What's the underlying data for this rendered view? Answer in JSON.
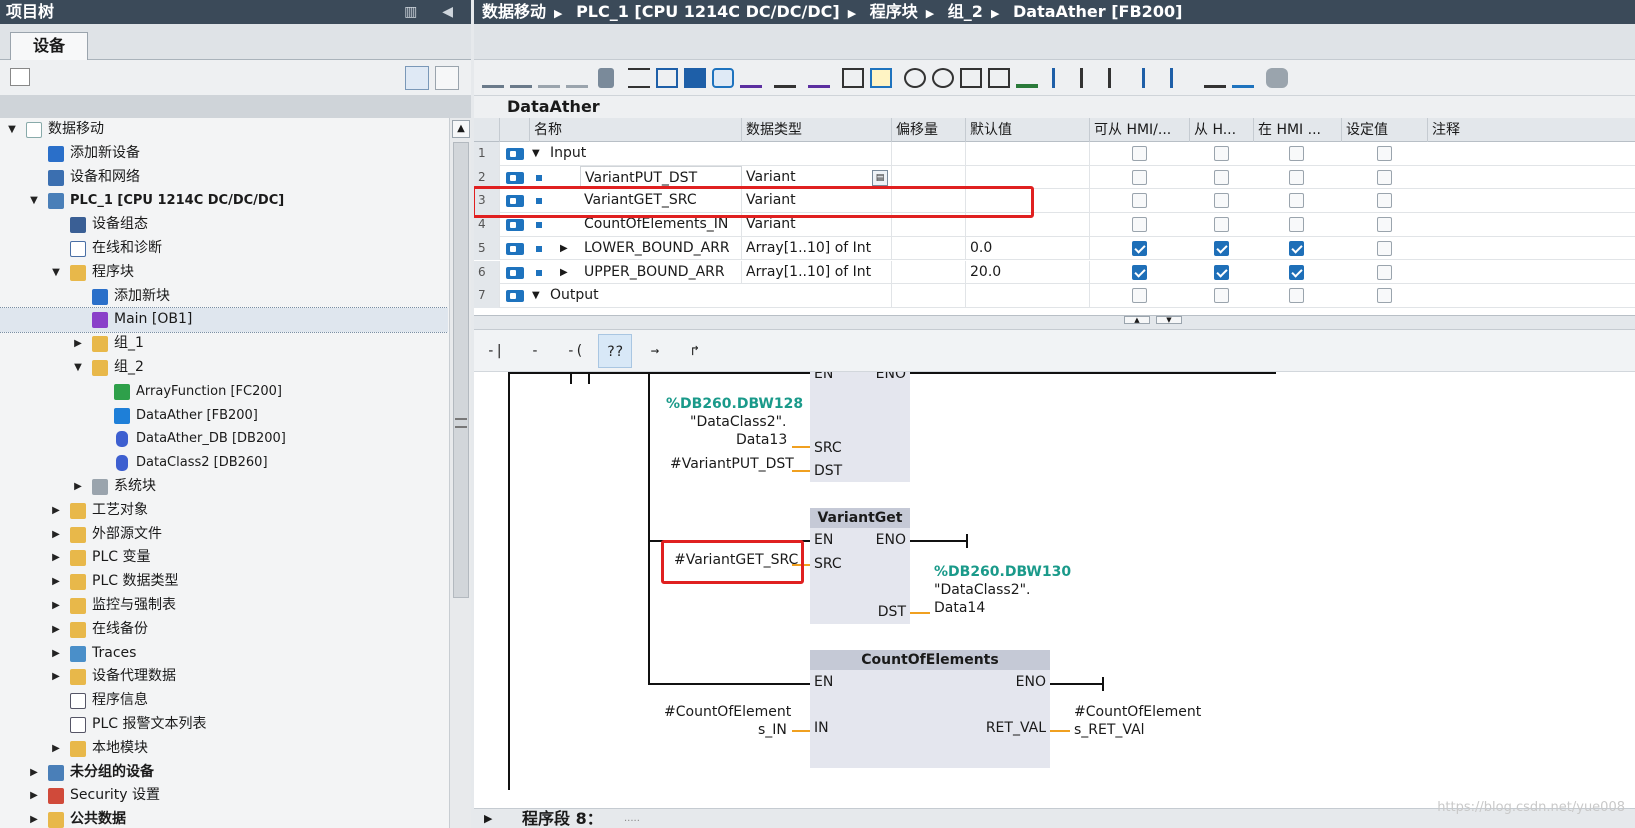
{
  "project_tree": {
    "title": "项目树",
    "tab": "设备",
    "items": [
      {
        "label": "数据移动",
        "bold": false
      },
      {
        "label": "添加新设备",
        "bold": false
      },
      {
        "label": "设备和网络",
        "bold": false
      },
      {
        "label": "PLC_1 [CPU 1214C DC/DC/DC]",
        "bold": true
      },
      {
        "label": "设备组态",
        "bold": false
      },
      {
        "label": "在线和诊断",
        "bold": false
      },
      {
        "label": "程序块",
        "bold": false
      },
      {
        "label": "添加新块",
        "bold": false
      },
      {
        "label": "Main [OB1]",
        "bold": false
      },
      {
        "label": "组_1",
        "bold": false
      },
      {
        "label": "组_2",
        "bold": false
      },
      {
        "label": "ArrayFunction [FC200]",
        "bold": false
      },
      {
        "label": "DataAther [FB200]",
        "bold": false
      },
      {
        "label": "DataAther_DB [DB200]",
        "bold": false
      },
      {
        "label": "DataClass2 [DB260]",
        "bold": false
      },
      {
        "label": "系统块",
        "bold": false
      },
      {
        "label": "工艺对象",
        "bold": false
      },
      {
        "label": "外部源文件",
        "bold": false
      },
      {
        "label": "PLC 变量",
        "bold": false
      },
      {
        "label": "PLC 数据类型",
        "bold": false
      },
      {
        "label": "监控与强制表",
        "bold": false
      },
      {
        "label": "在线备份",
        "bold": false
      },
      {
        "label": "Traces",
        "bold": false
      },
      {
        "label": "设备代理数据",
        "bold": false
      },
      {
        "label": "程序信息",
        "bold": false
      },
      {
        "label": "PLC 报警文本列表",
        "bold": false
      },
      {
        "label": "本地模块",
        "bold": false
      },
      {
        "label": "未分组的设备",
        "bold": true
      },
      {
        "label": "Security 设置",
        "bold": false
      },
      {
        "label": "公共数据",
        "bold": true
      }
    ]
  },
  "breadcrumb": [
    "数据移动",
    "PLC_1 [CPU 1214C DC/DC/DC]",
    "程序块",
    "组_2",
    "DataAther [FB200]"
  ],
  "block_name": "DataAther",
  "interface": {
    "headers": [
      "名称",
      "数据类型",
      "偏移量",
      "默认值",
      "可从 HMI/...",
      "从 H...",
      "在 HMI ...",
      "设定值",
      "注释"
    ],
    "rows": [
      {
        "num": "1",
        "name": "Input",
        "type": "",
        "default": "",
        "c1": false,
        "c2": false,
        "c3": false,
        "c4": false,
        "section": true
      },
      {
        "num": "2",
        "name": "VariantPUT_DST",
        "type": "Variant",
        "default": "",
        "c1": false,
        "c2": false,
        "c3": false,
        "c4": false
      },
      {
        "num": "3",
        "name": "VariantGET_SRC",
        "type": "Variant",
        "default": "",
        "c1": false,
        "c2": false,
        "c3": false,
        "c4": false
      },
      {
        "num": "4",
        "name": "CountOfElements_IN",
        "type": "Variant",
        "default": "",
        "c1": false,
        "c2": false,
        "c3": false,
        "c4": false
      },
      {
        "num": "5",
        "name": "LOWER_BOUND_ARR",
        "type": "Array[1..10] of Int",
        "default": "0.0",
        "c1": true,
        "c2": true,
        "c3": true,
        "c4": false,
        "expand": true
      },
      {
        "num": "6",
        "name": "UPPER_BOUND_ARR",
        "type": "Array[1..10] of Int",
        "default": "20.0",
        "c1": true,
        "c2": true,
        "c3": true,
        "c4": false,
        "expand": true
      },
      {
        "num": "7",
        "name": "Output",
        "type": "",
        "default": "",
        "c1": false,
        "c2": false,
        "c3": false,
        "c4": false,
        "section": true
      }
    ]
  },
  "ladder_tools": [
    "-| |-",
    "-|/|-",
    "-( )-",
    "??",
    "→",
    "↱"
  ],
  "ladder": {
    "put_block": {
      "en": "EN",
      "eno": "ENO",
      "src_label": "SRC",
      "dst_label": "DST",
      "src_addr": "%DB260.DBW128",
      "src_var1": "\"DataClass2\".",
      "src_var2": "Data13",
      "dst_var": "#VariantPUT_DST"
    },
    "get_block": {
      "title": "VariantGet",
      "en": "EN",
      "eno": "ENO",
      "src_label": "SRC",
      "dst_label": "DST",
      "src_var": "#VariantGET_SRC",
      "dst_addr": "%DB260.DBW130",
      "dst_var1": "\"DataClass2\".",
      "dst_var2": "Data14"
    },
    "count_block": {
      "title": "CountOfElements",
      "en": "EN",
      "eno": "ENO",
      "in_label": "IN",
      "ret_label": "RET_VAL",
      "in_var1": "#CountOfElement",
      "in_var2": "s_IN",
      "ret_var1": "#CountOfElement",
      "ret_var2": "s_RET_VAl"
    }
  },
  "segment": {
    "label": "程序段 8：",
    "comment": "....."
  },
  "watermark": "https://blog.csdn.net/yue008",
  "colors": {
    "title_bar": "#3b4a59",
    "highlight": "#e02020",
    "wire_orange": "#f0a020",
    "address_teal": "#1a9a8a"
  }
}
